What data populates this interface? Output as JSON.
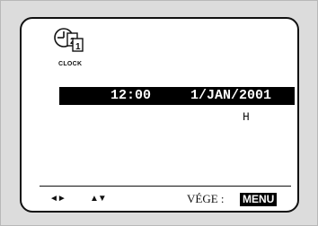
{
  "icon": {
    "name": "clock-icon",
    "label": "CLOCK"
  },
  "clock": {
    "time": "12:00",
    "date": "1/JAN/2001"
  },
  "cursor_indicator": "H",
  "nav": {
    "left_right": "◄►",
    "up_down": "▲▼",
    "exit_label": "VÉGE :",
    "menu_button": "MENU"
  }
}
